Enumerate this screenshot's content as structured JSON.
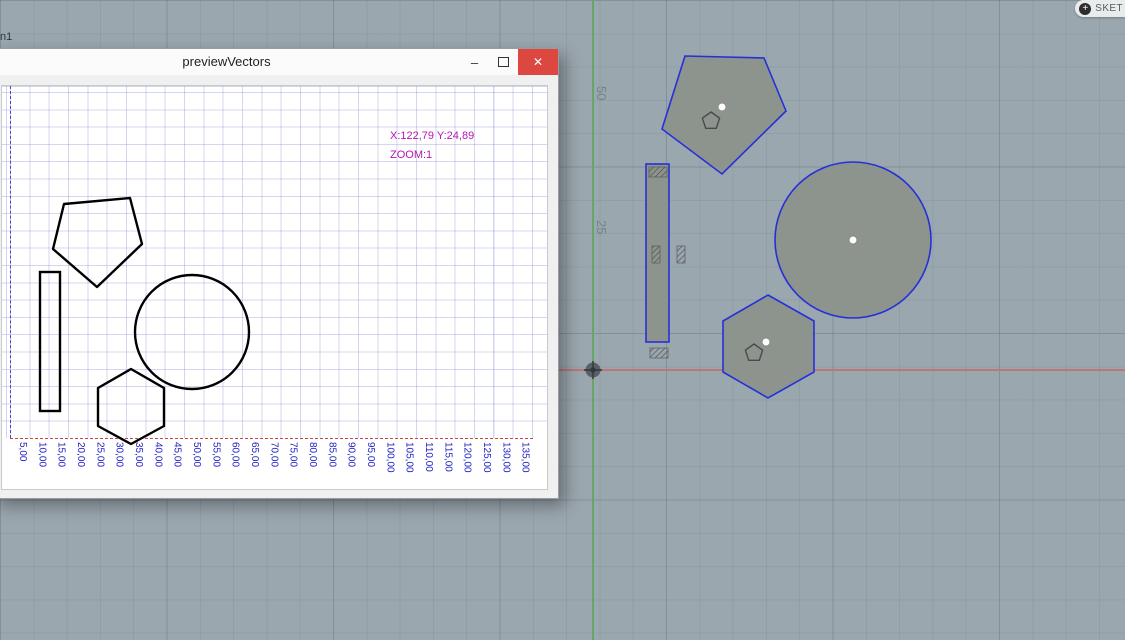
{
  "app": {
    "sketch_button_label": "SKET",
    "sketch_button_icon": "plus-circle-icon",
    "browser_fragment_label": "n1",
    "grid_axis_labels": {
      "fifty": "50",
      "twentyfive": "25"
    },
    "colors": {
      "background": "#9ba7ae",
      "axis_vertical_green": "#63a863",
      "axis_horizontal_red": "#bc7676",
      "sketch_shape_stroke": "#2531d8",
      "sketch_shape_fill": "#8d938c"
    }
  },
  "preview_window": {
    "title": "previewVectors",
    "controls": {
      "minimize_glyph": "–",
      "maximize_icon": "square-outline",
      "close_glyph": "✕"
    },
    "readout": {
      "position": "X:122,79 Y:24,89",
      "zoom": "ZOOM:1",
      "text_color": "#b515b5"
    },
    "tick_color": "#2323c8",
    "tick_labels": [
      "5,00",
      "10,00",
      "15,00",
      "20,00",
      "25,00",
      "30,00",
      "35,00",
      "40,00",
      "45,00",
      "50,00",
      "55,00",
      "60,00",
      "65,00",
      "70,00",
      "75,00",
      "80,00",
      "85,00",
      "90,00",
      "95,00",
      "100,00",
      "105,00",
      "110,00",
      "115,00",
      "120,00",
      "125,00",
      "130,00",
      "135,00"
    ]
  }
}
